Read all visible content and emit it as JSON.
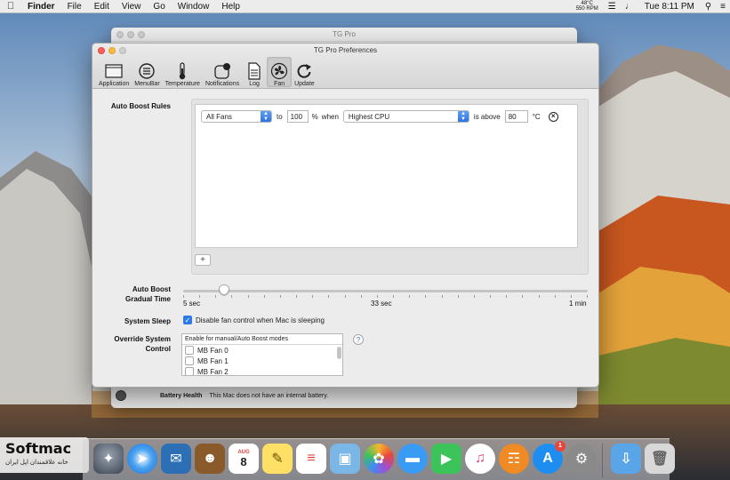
{
  "menubar": {
    "app": "Finder",
    "items": [
      "File",
      "Edit",
      "View",
      "Go",
      "Window",
      "Help"
    ],
    "temp_top": "48°C",
    "temp_bottom": "550 RPM",
    "clock": "Tue 8:11 PM"
  },
  "back_window": {
    "title": "TG Pro",
    "battery_label": "Battery Health",
    "battery_text": "This Mac does not have an internal battery."
  },
  "prefs": {
    "title": "TG Pro Preferences",
    "toolbar": [
      {
        "label": "Application",
        "icon": "application-icon"
      },
      {
        "label": "MenuBar",
        "icon": "menubar-icon"
      },
      {
        "label": "Temperature",
        "icon": "thermometer-icon"
      },
      {
        "label": "Notifications",
        "icon": "notifications-icon"
      },
      {
        "label": "Log",
        "icon": "log-icon"
      },
      {
        "label": "Fan",
        "icon": "fan-icon",
        "active": true
      },
      {
        "label": "Update",
        "icon": "update-icon"
      }
    ],
    "auto_boost_rules_label": "Auto Boost  Rules",
    "rule": {
      "fan_select": "All Fans",
      "to_label": "to",
      "percent_value": "100",
      "percent_label": "%",
      "when_label": "when",
      "sensor_select": "Highest CPU",
      "is_above_label": "is above",
      "threshold_value": "80",
      "unit": "°C"
    },
    "add_rule_button": "+",
    "gradual_label_1": "Auto Boost",
    "gradual_label_2": "Gradual Time",
    "slider": {
      "min_label": "5 sec",
      "mid_label": "33 sec",
      "max_label": "1 min",
      "value_fraction": 0.1
    },
    "system_sleep_label": "System Sleep",
    "system_sleep_checkbox": "Disable fan control when Mac is sleeping",
    "override_label_1": "Override System",
    "override_label_2": "Control",
    "override_header": "Enable for manual/Auto Boost modes",
    "override_items": [
      "MB Fan 0",
      "MB Fan 1",
      "MB Fan 2"
    ],
    "help_button": "?"
  },
  "watermark": {
    "brand": "Softmac",
    "tagline": "خانه علاقمندان اپل ایران"
  },
  "dock": {
    "calendar_month": "AUG",
    "calendar_day": "8",
    "appstore_badge": "1"
  },
  "colors": {
    "accent": "#2f7be5",
    "close_red": "#fc605c",
    "minimize_yellow": "#fdbc40"
  }
}
